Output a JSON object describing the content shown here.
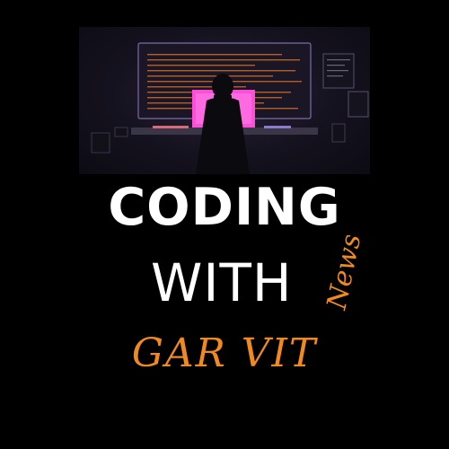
{
  "logo": {
    "line1": "CODING",
    "line2": "WITH",
    "tag": "News",
    "name": "GAR VIT"
  },
  "colors": {
    "background": "#000000",
    "text": "#ffffff",
    "accent": "#f08a1e",
    "screen_glow": "#ff4fd8"
  },
  "hero": {
    "scene": "developer-at-desk-illustration"
  }
}
